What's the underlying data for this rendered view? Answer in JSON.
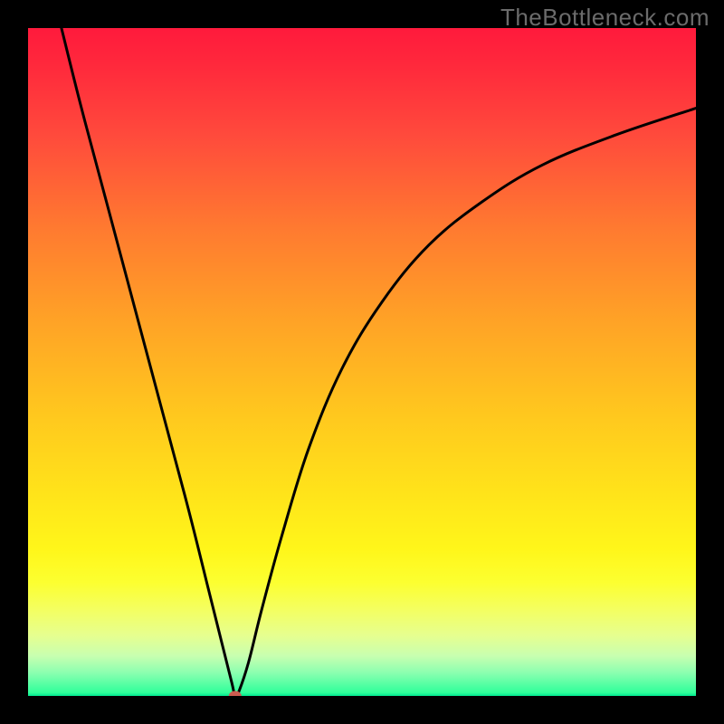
{
  "watermark": "TheBottleneck.com",
  "chart_data": {
    "type": "line",
    "title": "",
    "xlabel": "",
    "ylabel": "",
    "xlim": [
      0,
      100
    ],
    "ylim": [
      0,
      100
    ],
    "grid": false,
    "legend": false,
    "background_gradient": {
      "top": "#ff1a3c",
      "mid": "#ffe41a",
      "bottom": "#00e890"
    },
    "marker": {
      "x": 31,
      "y": 0,
      "color": "#cc5c50",
      "radius_px": 6
    },
    "series": [
      {
        "name": "curve",
        "color": "#000000",
        "x": [
          5,
          8,
          12,
          16,
          20,
          24,
          27,
          29,
          30.5,
          31,
          31.5,
          33,
          35,
          38,
          42,
          47,
          53,
          60,
          68,
          77,
          88,
          100
        ],
        "y": [
          100,
          88,
          73,
          58,
          43,
          28,
          16,
          8,
          2,
          0,
          0.5,
          5,
          13,
          24,
          37,
          49,
          59,
          67.5,
          74,
          79.5,
          84,
          88
        ]
      }
    ]
  }
}
